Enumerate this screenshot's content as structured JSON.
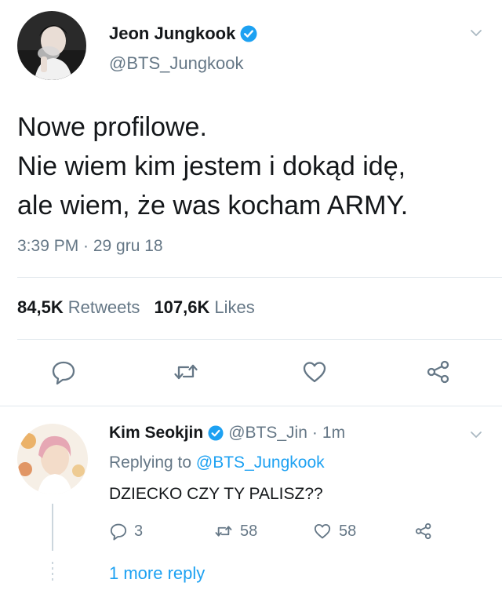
{
  "tweet": {
    "author_name": "Jeon Jungkook",
    "author_handle": "@BTS_Jungkook",
    "text_lines": [
      "Nowe profilowe.",
      "Nie wiem kim jestem i dokąd idę,",
      "ale wiem, że was kocham ARMY."
    ],
    "timestamp": "3:39 PM · 29 gru 18",
    "retweets_count": "84,5K",
    "retweets_label": "Retweets",
    "likes_count": "107,6K",
    "likes_label": "Likes"
  },
  "reply": {
    "author_name": "Kim Seokjin",
    "author_handle": "@BTS_Jin",
    "separator": "·",
    "time": "1m",
    "replying_prefix": "Replying to",
    "replying_handle": "@BTS_Jungkook",
    "text": "DZIECKO CZY TY PALISZ??",
    "reply_count": "3",
    "retweet_count": "58",
    "like_count": "58"
  },
  "more_replies_label": "1 more reply",
  "colors": {
    "accent": "#1da1f2",
    "secondary_text": "#657786",
    "icon_gray": "#657786",
    "divider": "#e1e8ed"
  },
  "icons": {
    "verified": "verified-badge-icon",
    "chevron": "chevron-down-icon",
    "reply": "reply-icon",
    "retweet": "retweet-icon",
    "like": "heart-icon",
    "share": "share-icon"
  }
}
